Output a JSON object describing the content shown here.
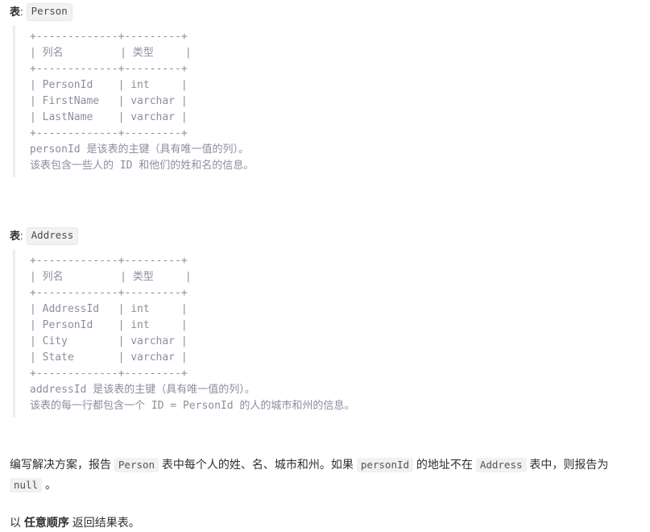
{
  "person_section": {
    "label_prefix": "表",
    "label_colon": ":",
    "table_name": "Person",
    "schema": "+-------------+---------+\n| 列名         | 类型     |\n+-------------+---------+\n| PersonId    | int     |\n| FirstName   | varchar |\n| LastName    | varchar |\n+-------------+---------+\npersonId 是该表的主键（具有唯一值的列）。\n该表包含一些人的 ID 和他们的姓和名的信息。"
  },
  "address_section": {
    "label_prefix": "表",
    "label_colon": ":",
    "table_name": "Address",
    "schema": "+-------------+---------+\n| 列名         | 类型     |\n+-------------+---------+\n| AddressId   | int     |\n| PersonId    | int     |\n| City        | varchar |\n| State       | varchar |\n+-------------+---------+\naddressId 是该表的主键（具有唯一值的列）。\n该表的每一行都包含一个 ID = PersonId 的人的城市和州的信息。"
  },
  "task": {
    "part1": "编写解决方案，报告 ",
    "code1": "Person",
    "part2": " 表中每个人的姓、名、城市和州。如果 ",
    "code2": "personId",
    "part3": " 的地址不在 ",
    "code3": "Address",
    "part4": " 表中，则报告为 ",
    "code4": "null",
    "part5": " 。"
  },
  "order_note": {
    "prefix": "以 ",
    "emphasis": "任意顺序",
    "suffix": " 返回结果表。"
  }
}
